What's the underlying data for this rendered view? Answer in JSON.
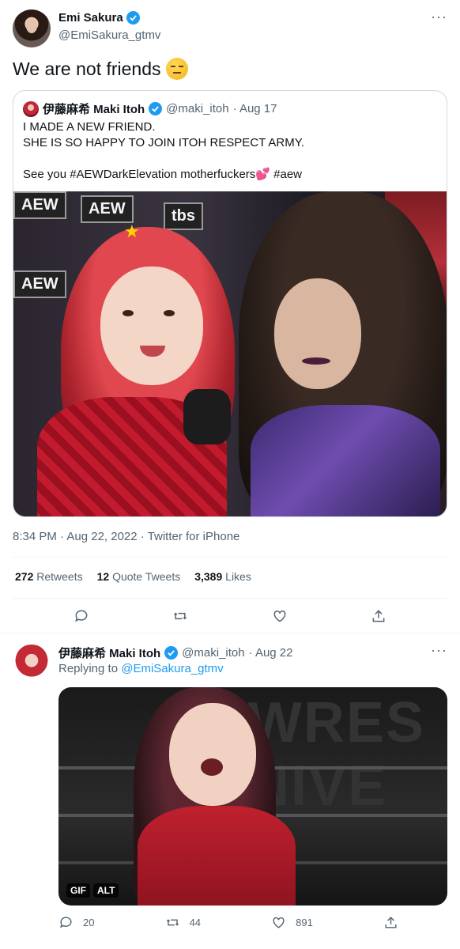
{
  "tweet": {
    "author_name": "Emi Sakura",
    "author_handle": "@EmiSakura_gtmv",
    "more_label": "···",
    "text": "We are not friends",
    "timestamp": "8:34 PM · Aug 22, 2022 · Twitter for iPhone",
    "stats": {
      "retweets_count": "272",
      "retweets_label": "Retweets",
      "quotes_count": "12",
      "quotes_label": "Quote Tweets",
      "likes_count": "3,389",
      "likes_label": "Likes"
    }
  },
  "quoted": {
    "author_name": "伊藤麻希 Maki Itoh",
    "author_handle": "@maki_itoh",
    "date": "· Aug 17",
    "text_main": "I MADE A NEW FRIEND.\nSHE IS SO HAPPY TO JOIN ITOH RESPECT ARMY.\n\nSee you #AEWDarkElevation motherfuckers",
    "heart": "💕",
    "hashtag": " #aew",
    "photo_banner_1": "AEW",
    "photo_banner_2": "tbs",
    "photo_banner_3": "AEW",
    "photo_banner_4": "AEW"
  },
  "reply": {
    "author_name": "伊藤麻希 Maki Itoh",
    "author_handle": "@maki_itoh",
    "date": "· Aug 22",
    "replying_prefix": "Replying to",
    "replying_to": "@EmiSakura_gtmv",
    "more_label": "···",
    "gif_bigtext": "WRES\nNIVE",
    "badge_gif": "GIF",
    "badge_alt": "ALT",
    "replies": "20",
    "retweets": "44",
    "likes": "891"
  },
  "colors": {
    "accent": "#1d9bf0",
    "secondary_text": "#536471",
    "border": "#cfd9de"
  }
}
